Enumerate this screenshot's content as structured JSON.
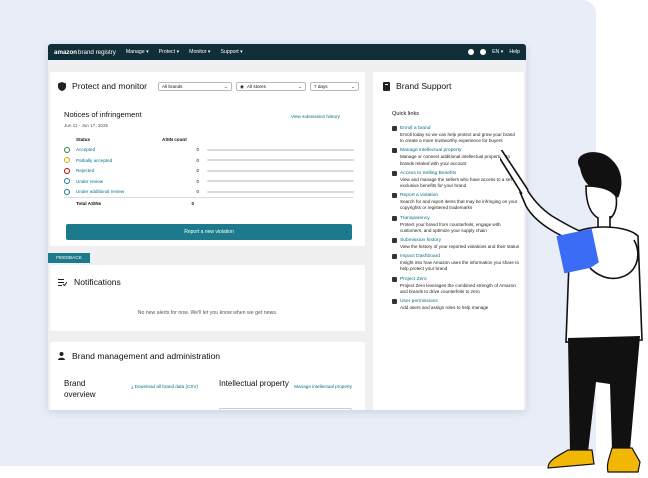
{
  "topbar": {
    "logo_main": "amazon",
    "logo_sub": "brand registry",
    "menu": [
      "Manage ▾",
      "Protect ▾",
      "Monitor ▾",
      "Support ▾"
    ],
    "lang": "EN ▾",
    "help": "Help"
  },
  "protect": {
    "title": "Protect and monitor",
    "brands_select": "All brands",
    "stores_select": "All stores",
    "days_select": "7 days",
    "notices_title": "Notices of infringement",
    "date_range": "Jun 11 - Jun 17, 2025",
    "history_link": "View submission history",
    "col_status": "Status",
    "col_count": "ASIN count",
    "rows": [
      {
        "label": "Accepted",
        "count": "0",
        "color": "#2e8540"
      },
      {
        "label": "Partially accepted",
        "count": "0",
        "color": "#d7a500"
      },
      {
        "label": "Rejected",
        "count": "0",
        "color": "#c40000"
      },
      {
        "label": "Under review",
        "count": "0",
        "color": "#1c7a8c"
      },
      {
        "label": "Under additional review",
        "count": "0",
        "color": "#1c7a8c"
      }
    ],
    "total_label": "Total ASINs",
    "total_value": "0",
    "report_button": "Report a new violation"
  },
  "feedback": "FEEDBACK",
  "notifications": {
    "title": "Notifications",
    "empty": "No new alerts for now. We'll let you know when we get news."
  },
  "brand_mgmt": {
    "title": "Brand management and administration",
    "overview_title": "Brand overview",
    "download_link": "Download all brand data (CSV)",
    "ip_title": "Intellectual property",
    "manage_ip_link": "Manage intellectual property"
  },
  "support": {
    "title": "Brand Support",
    "quick_links_label": "Quick links",
    "links": [
      {
        "title": "Enroll a brand",
        "desc": "Enroll today so we can help protect and grow your brand to create a more trustworthy experience for buyers"
      },
      {
        "title": "Manage intellectual property",
        "desc": "Manage or connect additional intellectual properties to brands related with your account"
      },
      {
        "title": "Access to Selling Benefits",
        "desc": "View and manage the sellers who have access to a set of exclusive benefits for your brand"
      },
      {
        "title": "Report a violation",
        "desc": "Search for and report items that may be infringing on your copyrights or registered trademarks"
      },
      {
        "title": "Transparency",
        "desc": "Protect your brand from counterfeits, engage with customers, and optimize your supply chain"
      },
      {
        "title": "Submission history",
        "desc": "View the history of your reported violations and their status"
      },
      {
        "title": "Impact Dashboard",
        "desc": "Insight into how Amazon uses the information you share to help protect your brand"
      },
      {
        "title": "Project Zero",
        "desc": "Project Zero leverages the combined strength of Amazon and brands to drive counterfeits to zero"
      },
      {
        "title": "User permissions",
        "desc": "Add users and assign roles to help manage"
      }
    ]
  }
}
